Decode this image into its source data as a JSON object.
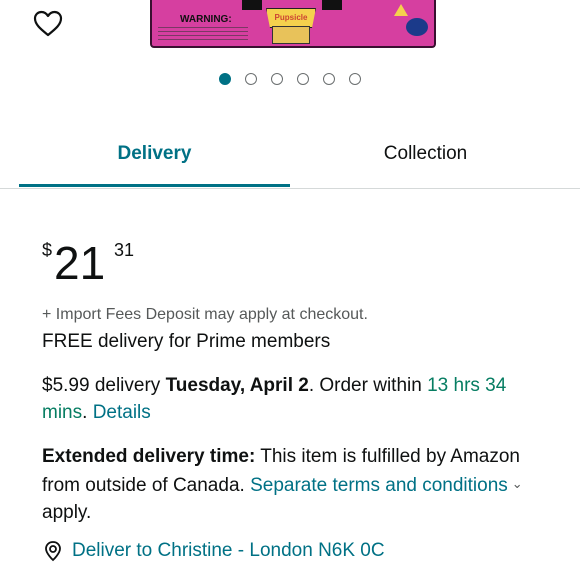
{
  "product_image": {
    "warning_label": "WARNING:",
    "tag_label": "Pupsicle"
  },
  "carousel": {
    "dot_count": 6,
    "active_index": 0
  },
  "tabs": [
    {
      "label": "Delivery",
      "selected": true
    },
    {
      "label": "Collection",
      "selected": false
    }
  ],
  "price": {
    "symbol": "$",
    "whole": "21",
    "fraction": "31"
  },
  "import_fees": "+ Import Fees Deposit may apply at checkout.",
  "free_delivery": "FREE delivery for Prime members",
  "delivery": {
    "cost": "$5.99 delivery",
    "date": "Tuesday, April 2",
    "order_within_prefix": ". Order within ",
    "time_left": "13 hrs 34 mins",
    "separator": ".",
    "details_link": "Details"
  },
  "extended": {
    "title": "Extended delivery time:",
    "text": "This item is fulfilled by Amazon from outside of Canada.",
    "link": "Separate terms and conditions",
    "suffix": "apply."
  },
  "deliver_to": "Deliver to Christine - London N6K 0C",
  "colors": {
    "accent": "#007185",
    "green": "#067d62",
    "text": "#0f1111",
    "muted": "#565959",
    "product_pink": "#d63fa0"
  }
}
